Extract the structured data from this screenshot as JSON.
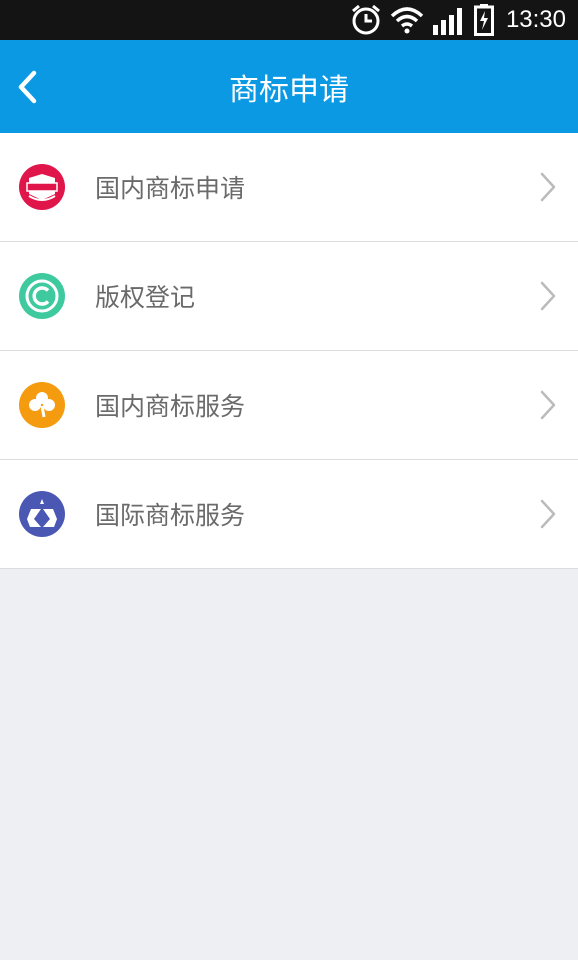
{
  "status_bar": {
    "time": "13:30"
  },
  "header": {
    "title": "商标申请"
  },
  "menu": [
    {
      "label": "国内商标申请",
      "icon": "cimo-icon",
      "color": "#e0154a"
    },
    {
      "label": "版权登记",
      "icon": "copyright-icon",
      "color": "#3ec99e"
    },
    {
      "label": "国内商标服务",
      "icon": "clover-icon",
      "color": "#f49b0f"
    },
    {
      "label": "国际商标服务",
      "icon": "emblem-icon",
      "color": "#4a58b4"
    }
  ],
  "colors": {
    "header_bg": "#0b99e3",
    "page_bg": "#eeeff3"
  }
}
